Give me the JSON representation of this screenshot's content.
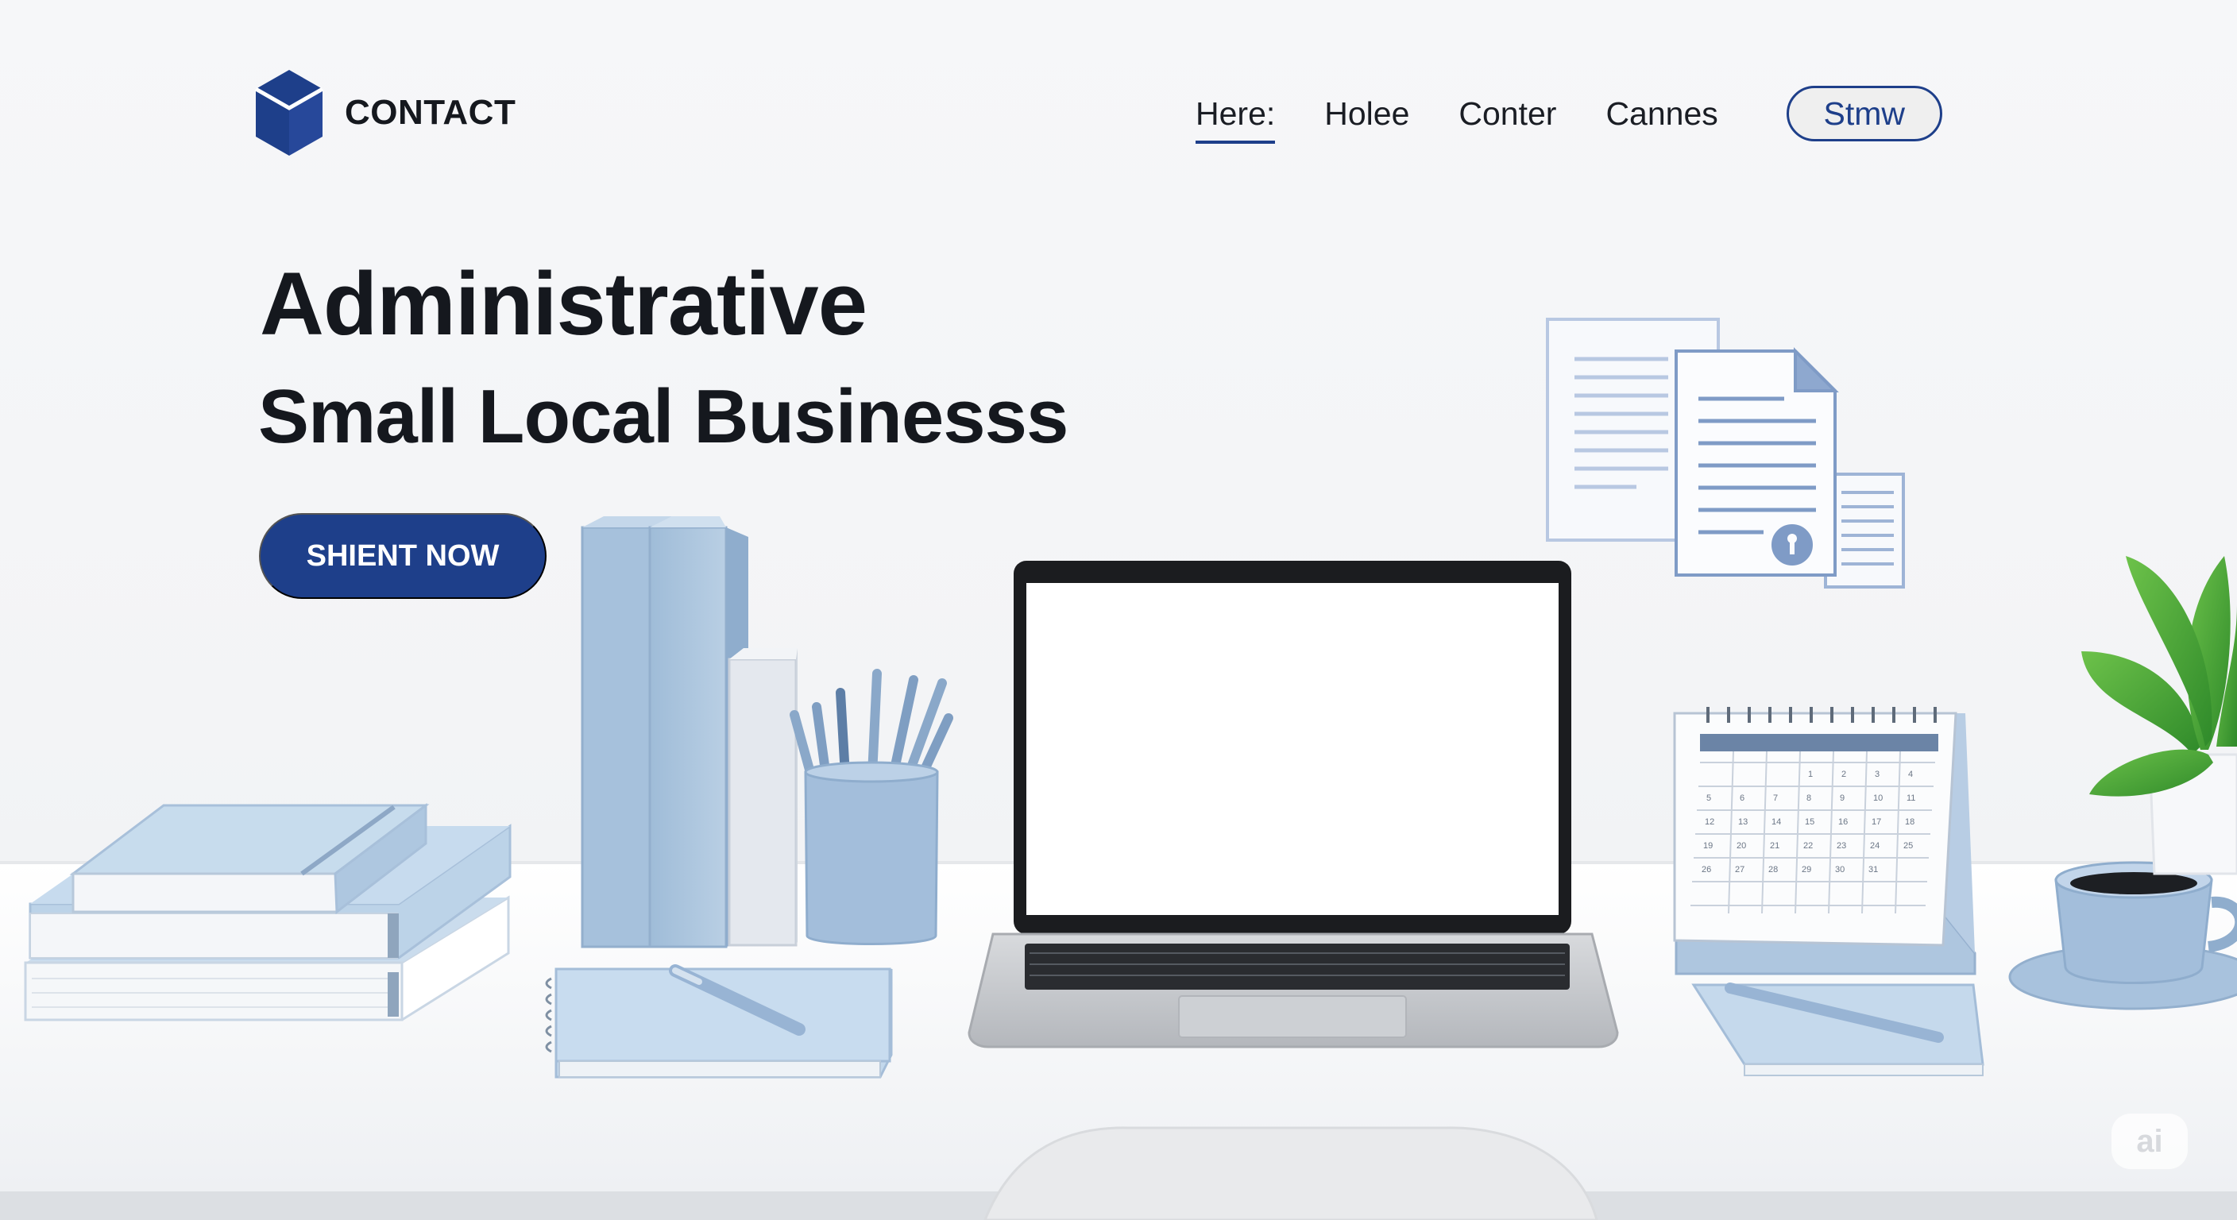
{
  "brand": {
    "name": "CONTACT",
    "logo_icon": "cube-icon",
    "logo_color": "#1e3f8a"
  },
  "nav": {
    "links": [
      {
        "label": "Here:",
        "active": true
      },
      {
        "label": "Holee",
        "active": false
      },
      {
        "label": "Conter",
        "active": false
      },
      {
        "label": "Cannes",
        "active": false
      }
    ],
    "button_label": "Stmw"
  },
  "hero": {
    "title": "Administrative",
    "subtitle": "Small Local Businesss",
    "cta_label": "SHIENT NOW"
  },
  "watermark": "ai",
  "colors": {
    "accent": "#1e3f8a",
    "pastel_blue": "#a9c4de",
    "background": "#f4f5f7"
  },
  "illustration": {
    "items": [
      "document-stack-icon",
      "binders",
      "pen-cup",
      "laptop",
      "desk-calendar",
      "coffee-cup",
      "notebooks",
      "plant"
    ],
    "calendar_days": [
      "1",
      "2",
      "3",
      "4",
      "5",
      "6",
      "7",
      "8",
      "9",
      "10",
      "11",
      "12",
      "13",
      "14",
      "15",
      "16",
      "17",
      "18",
      "19",
      "20",
      "21",
      "22",
      "23",
      "24",
      "25",
      "26",
      "27",
      "28",
      "29",
      "30",
      "31"
    ]
  }
}
